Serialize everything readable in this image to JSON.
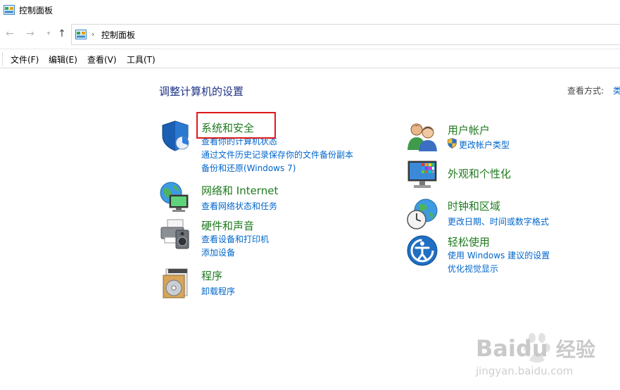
{
  "window": {
    "title": "控制面板"
  },
  "address": {
    "crumb": "控制面板",
    "separator": "›"
  },
  "menus": [
    "文件(F)",
    "编辑(E)",
    "查看(V)",
    "工具(T)"
  ],
  "main": {
    "heading": "调整计算机的设置",
    "view_by_label": "查看方式:",
    "view_by_value": "类"
  },
  "categories": [
    {
      "title": "系统和安全",
      "icon": "shield-icon",
      "links": [
        "查看你的计算机状态",
        "通过文件历史记录保存你的文件备份副本",
        "备份和还原(Windows 7)"
      ]
    },
    {
      "title": "网络和 Internet",
      "icon": "network-globe-icon",
      "links": [
        "查看网络状态和任务"
      ]
    },
    {
      "title": "硬件和声音",
      "icon": "printer-speaker-icon",
      "links": [
        "查看设备和打印机",
        "添加设备"
      ]
    },
    {
      "title": "程序",
      "icon": "programs-disc-icon",
      "links": [
        "卸载程序"
      ]
    },
    {
      "title": "用户帐户",
      "icon": "users-icon",
      "links": [
        "更改帐户类型"
      ]
    },
    {
      "title": "外观和个性化",
      "icon": "monitor-palette-icon",
      "links": []
    },
    {
      "title": "时钟和区域",
      "icon": "clock-globe-icon",
      "links": [
        "更改日期、时间或数字格式"
      ]
    },
    {
      "title": "轻松使用",
      "icon": "ease-of-access-icon",
      "links": [
        "使用 Windows 建议的设置",
        "优化视觉显示"
      ]
    }
  ],
  "watermark": {
    "brand": "Baidu",
    "suffix": "经验",
    "url": "jingyan.baidu.com"
  },
  "colors": {
    "category_title": "#1f7a1f",
    "link": "#0066cc",
    "heading": "#1e3287",
    "highlight": "#e0191b"
  }
}
